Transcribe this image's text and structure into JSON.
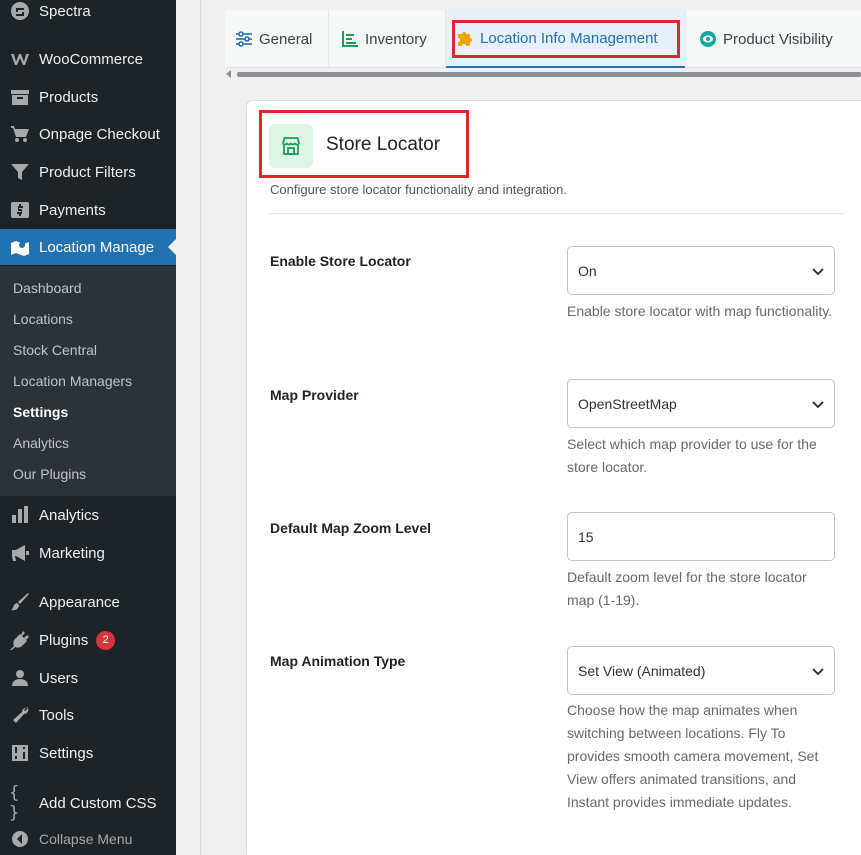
{
  "sidebar": {
    "menu": [
      {
        "label": "Spectra",
        "icon": "spectra-icon"
      },
      {
        "label": "WooCommerce",
        "icon": "woocommerce-icon"
      },
      {
        "label": "Products",
        "icon": "archive-icon"
      },
      {
        "label": "Onpage Checkout",
        "icon": "cart-icon"
      },
      {
        "label": "Product Filters",
        "icon": "filter-icon"
      },
      {
        "label": "Payments",
        "icon": "dollar-icon"
      },
      {
        "label": "Location Manage",
        "icon": "map-location-icon"
      }
    ],
    "submenu": [
      "Dashboard",
      "Locations",
      "Stock Central",
      "Location Managers",
      "Settings",
      "Analytics",
      "Our Plugins"
    ],
    "submenu_current": "Settings",
    "menu2": [
      {
        "label": "Analytics",
        "icon": "bar-chart-icon"
      },
      {
        "label": "Marketing",
        "icon": "megaphone-icon"
      },
      {
        "label": "Appearance",
        "icon": "paintbrush-icon"
      },
      {
        "label": "Plugins",
        "icon": "plugin-icon",
        "badge": "2"
      },
      {
        "label": "Users",
        "icon": "users-icon"
      },
      {
        "label": "Tools",
        "icon": "wrench-icon"
      },
      {
        "label": "Settings",
        "icon": "settings-icon"
      },
      {
        "label": "Add Custom CSS",
        "icon": "braces-icon"
      }
    ],
    "collapse_label": "Collapse Menu"
  },
  "tabs": [
    {
      "label": "General",
      "icon": "sliders-icon"
    },
    {
      "label": "Inventory",
      "icon": "inventory-icon"
    },
    {
      "label": "Location Info Management",
      "icon": "puzzle-icon",
      "active": true
    },
    {
      "label": "Product Visibility",
      "icon": "eye-icon"
    }
  ],
  "card": {
    "title": "Store Locator",
    "icon": "store-icon",
    "description": "Configure store locator functionality and integration."
  },
  "fields": [
    {
      "label": "Enable Store Locator",
      "value": "On",
      "type": "select",
      "help": "Enable store locator with map functionality."
    },
    {
      "label": "Map Provider",
      "value": "OpenStreetMap",
      "type": "select",
      "help": "Select which map provider to use for the store locator."
    },
    {
      "label": "Default Map Zoom Level",
      "value": "15",
      "type": "number",
      "help": "Default zoom level for the store locator map (1-19)."
    },
    {
      "label": "Map Animation Type",
      "value": "Set View (Animated)",
      "type": "select",
      "help": "Choose how the map animates when switching between locations. Fly To provides smooth camera movement, Set View offers animated transitions, and Instant provides immediate updates."
    }
  ],
  "colors": {
    "accent": "#2271b1",
    "sidebar": "#1d2327",
    "highlight": "#e0262b",
    "store_icon_bg": "#dcf5e7"
  }
}
